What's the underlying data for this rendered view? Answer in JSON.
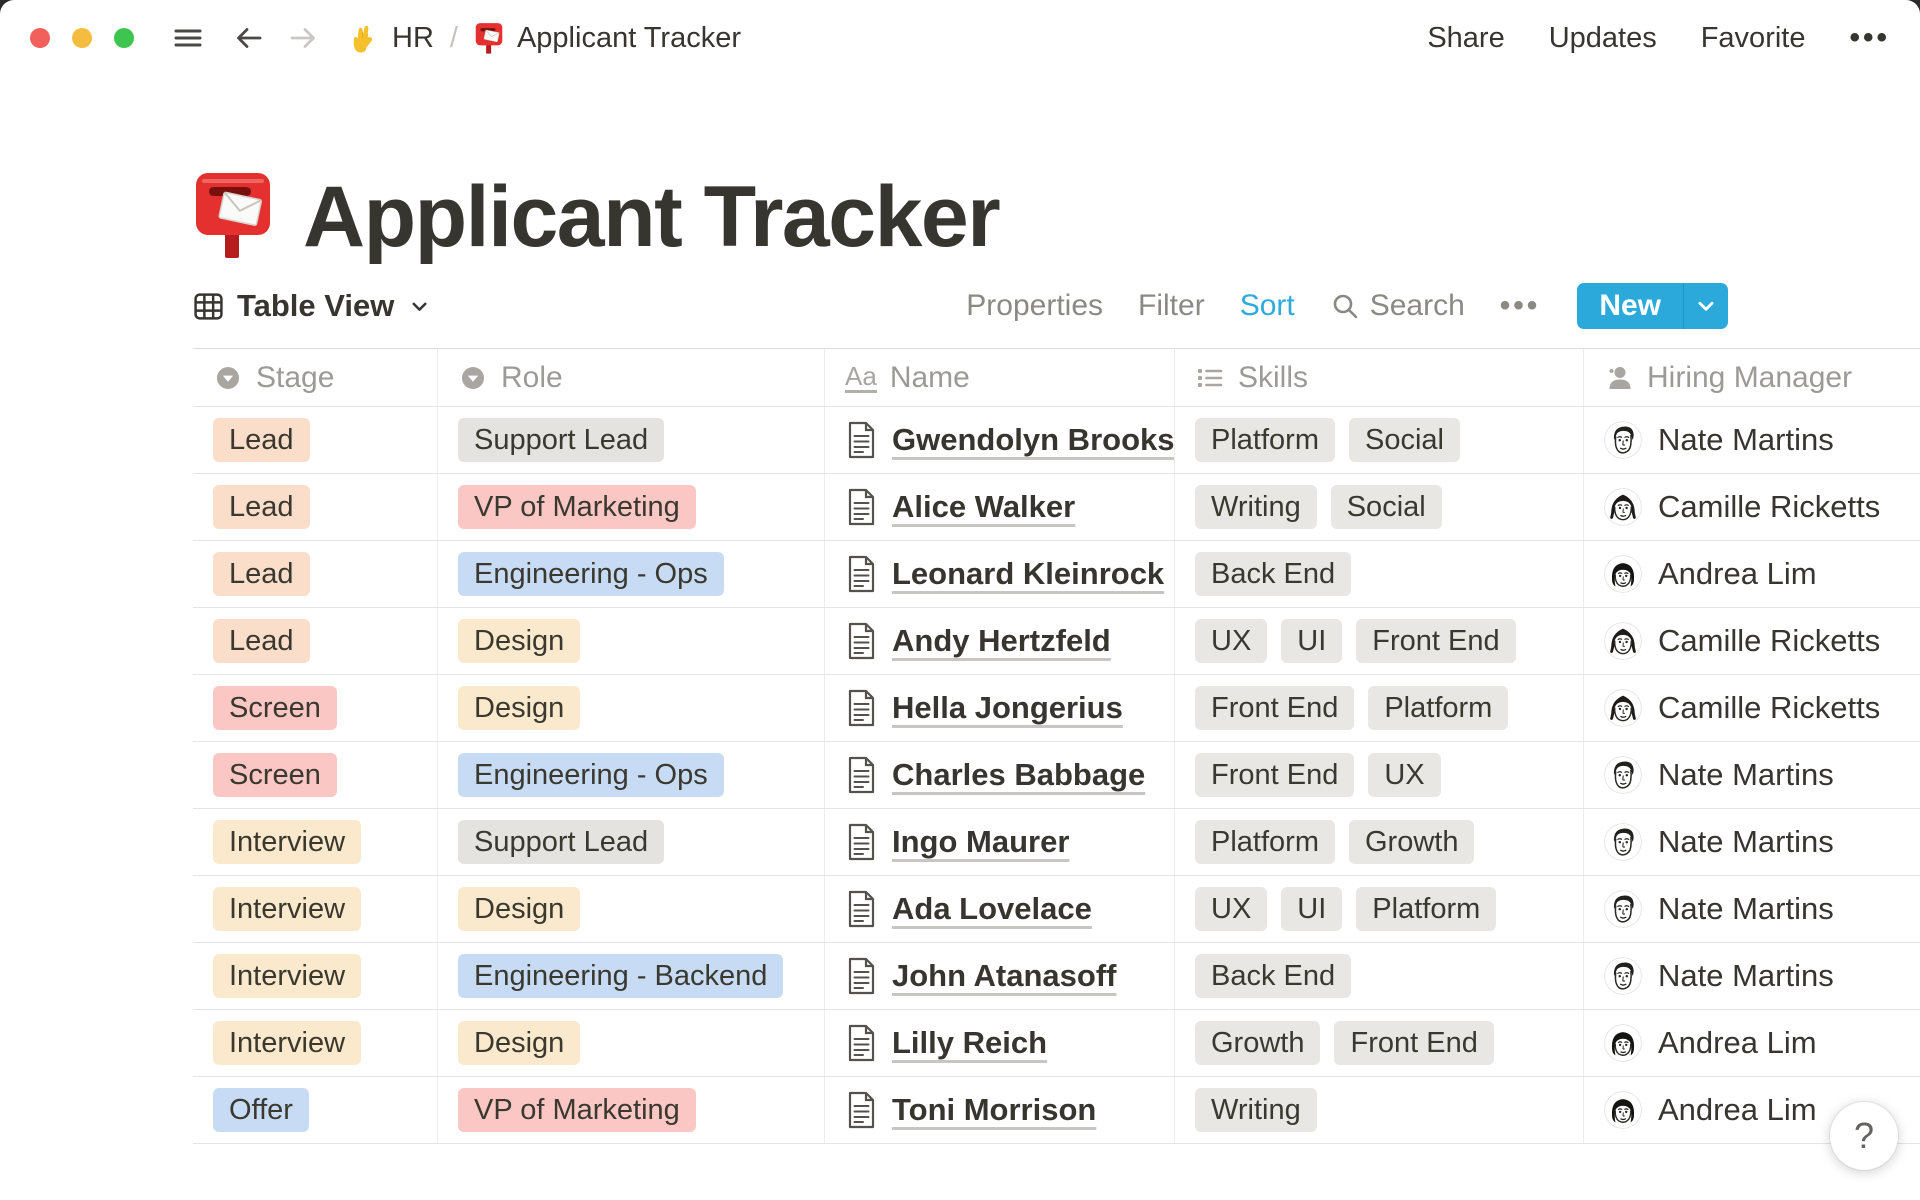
{
  "topbar": {
    "window_controls": {
      "close": "close",
      "minimize": "minimize",
      "zoom": "zoom"
    },
    "breadcrumb": {
      "workspace_icon": "victory-hand",
      "workspace": "HR",
      "separator": "/",
      "page_icon": "mailbox",
      "page": "Applicant Tracker"
    },
    "actions": {
      "share": "Share",
      "updates": "Updates",
      "favorite": "Favorite",
      "more": "•••"
    }
  },
  "page": {
    "icon": "mailbox",
    "title": "Applicant Tracker"
  },
  "toolbar": {
    "view_icon": "table-icon",
    "view_label": "Table View",
    "properties": "Properties",
    "filter": "Filter",
    "sort": "Sort",
    "sort_active": true,
    "search": "Search",
    "search_icon": "search-icon",
    "more": "•••",
    "new_label": "New"
  },
  "colors": {
    "accent_blue": "#2EAADC",
    "new_button_bg": "#2BA9DB",
    "tag_orange": "#FADEC9",
    "tag_pink": "#FAC7C5",
    "tag_yellow": "#FAE9CC",
    "tag_blue": "#C7DCF4",
    "tag_gray": "#E4E3E0",
    "tag_skill_gray": "#E8E7E4",
    "text": "#37352F",
    "muted": "#9B9A97"
  },
  "table": {
    "columns": [
      {
        "id": "stage",
        "label": "Stage",
        "icon": "select-icon"
      },
      {
        "id": "role",
        "label": "Role",
        "icon": "select-icon"
      },
      {
        "id": "name",
        "label": "Name",
        "icon": "text-icon"
      },
      {
        "id": "skills",
        "label": "Skills",
        "icon": "list-icon"
      },
      {
        "id": "hiring_manager",
        "label": "Hiring Manager",
        "icon": "person-icon"
      }
    ],
    "rows": [
      {
        "stage": {
          "label": "Lead",
          "color": "orange"
        },
        "role": {
          "label": "Support Lead",
          "color": "gray"
        },
        "name": "Gwendolyn Brooks",
        "skills": [
          "Platform",
          "Social"
        ],
        "hiring_manager": {
          "name": "Nate Martins",
          "avatar": "nate"
        }
      },
      {
        "stage": {
          "label": "Lead",
          "color": "orange"
        },
        "role": {
          "label": "VP of Marketing",
          "color": "pink"
        },
        "name": "Alice Walker",
        "skills": [
          "Writing",
          "Social"
        ],
        "hiring_manager": {
          "name": "Camille Ricketts",
          "avatar": "camille"
        }
      },
      {
        "stage": {
          "label": "Lead",
          "color": "orange"
        },
        "role": {
          "label": "Engineering - Ops",
          "color": "blue"
        },
        "name": "Leonard Kleinrock",
        "skills": [
          "Back End"
        ],
        "hiring_manager": {
          "name": "Andrea Lim",
          "avatar": "andrea"
        }
      },
      {
        "stage": {
          "label": "Lead",
          "color": "orange"
        },
        "role": {
          "label": "Design",
          "color": "yellow"
        },
        "name": "Andy Hertzfeld",
        "skills": [
          "UX",
          "UI",
          "Front End"
        ],
        "hiring_manager": {
          "name": "Camille Ricketts",
          "avatar": "camille"
        }
      },
      {
        "stage": {
          "label": "Screen",
          "color": "pink"
        },
        "role": {
          "label": "Design",
          "color": "yellow"
        },
        "name": "Hella Jongerius",
        "skills": [
          "Front End",
          "Platform"
        ],
        "hiring_manager": {
          "name": "Camille Ricketts",
          "avatar": "camille"
        }
      },
      {
        "stage": {
          "label": "Screen",
          "color": "pink"
        },
        "role": {
          "label": "Engineering - Ops",
          "color": "blue"
        },
        "name": "Charles Babbage",
        "skills": [
          "Front End",
          "UX"
        ],
        "hiring_manager": {
          "name": "Nate Martins",
          "avatar": "nate"
        }
      },
      {
        "stage": {
          "label": "Interview",
          "color": "yellow"
        },
        "role": {
          "label": "Support Lead",
          "color": "gray"
        },
        "name": "Ingo Maurer",
        "skills": [
          "Platform",
          "Growth"
        ],
        "hiring_manager": {
          "name": "Nate Martins",
          "avatar": "nate"
        }
      },
      {
        "stage": {
          "label": "Interview",
          "color": "yellow"
        },
        "role": {
          "label": "Design",
          "color": "yellow"
        },
        "name": "Ada Lovelace",
        "skills": [
          "UX",
          "UI",
          "Platform"
        ],
        "hiring_manager": {
          "name": "Nate Martins",
          "avatar": "nate"
        }
      },
      {
        "stage": {
          "label": "Interview",
          "color": "yellow"
        },
        "role": {
          "label": "Engineering - Backend",
          "color": "blue"
        },
        "name": "John Atanasoff",
        "skills": [
          "Back End"
        ],
        "hiring_manager": {
          "name": "Nate Martins",
          "avatar": "nate"
        }
      },
      {
        "stage": {
          "label": "Interview",
          "color": "yellow"
        },
        "role": {
          "label": "Design",
          "color": "yellow"
        },
        "name": "Lilly Reich",
        "skills": [
          "Growth",
          "Front End"
        ],
        "hiring_manager": {
          "name": "Andrea Lim",
          "avatar": "andrea"
        }
      },
      {
        "stage": {
          "label": "Offer",
          "color": "blue"
        },
        "role": {
          "label": "VP of Marketing",
          "color": "pink"
        },
        "name": "Toni Morrison",
        "skills": [
          "Writing"
        ],
        "hiring_manager": {
          "name": "Andrea Lim",
          "avatar": "andrea"
        }
      }
    ]
  },
  "help_button": "?"
}
